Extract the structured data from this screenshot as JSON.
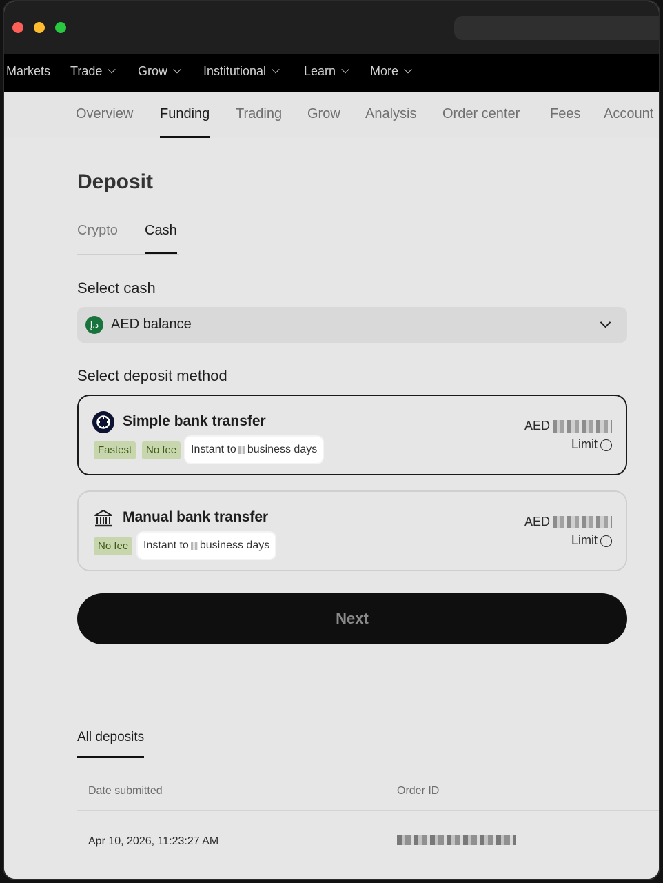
{
  "topnav": {
    "items": [
      {
        "label": "Markets",
        "has_menu": false
      },
      {
        "label": "Trade",
        "has_menu": true
      },
      {
        "label": "Grow",
        "has_menu": true
      },
      {
        "label": "Institutional",
        "has_menu": true
      },
      {
        "label": "Learn",
        "has_menu": true
      },
      {
        "label": "More",
        "has_menu": true
      }
    ]
  },
  "subnav": {
    "tabs": [
      "Overview",
      "Funding",
      "Trading",
      "Grow",
      "Analysis",
      "Order center",
      "Fees",
      "Account"
    ],
    "active": "Funding"
  },
  "page": {
    "title": "Deposit",
    "tabs": [
      "Crypto",
      "Cash"
    ],
    "active_tab": "Cash"
  },
  "select_cash": {
    "label": "Select cash",
    "icon_text": "د.إ",
    "value": "AED balance"
  },
  "deposit_method": {
    "label": "Select deposit method",
    "methods": [
      {
        "title": "Simple bank transfer",
        "icon": "coin-logo-icon",
        "tags": [
          "Fastest",
          "No fee"
        ],
        "speed_prefix": "Instant to",
        "speed_suffix": "business days",
        "currency": "AED",
        "limit_label": "Limit",
        "selected": true
      },
      {
        "title": "Manual bank transfer",
        "icon": "bank-icon",
        "tags": [
          "No fee"
        ],
        "speed_prefix": "Instant to",
        "speed_suffix": "business days",
        "currency": "AED",
        "limit_label": "Limit",
        "selected": false
      }
    ]
  },
  "next_button": "Next",
  "deposits": {
    "tab_label": "All deposits",
    "columns": [
      "Date submitted",
      "Order ID"
    ],
    "rows": [
      {
        "date": "Apr 10, 2026, 11:23:27 AM"
      }
    ]
  },
  "colors": {
    "tag_bg": "#c8d6ae",
    "tag_text": "#3e5a17",
    "primary_button": "#0f0f0f",
    "aed_icon": "#19733d"
  }
}
